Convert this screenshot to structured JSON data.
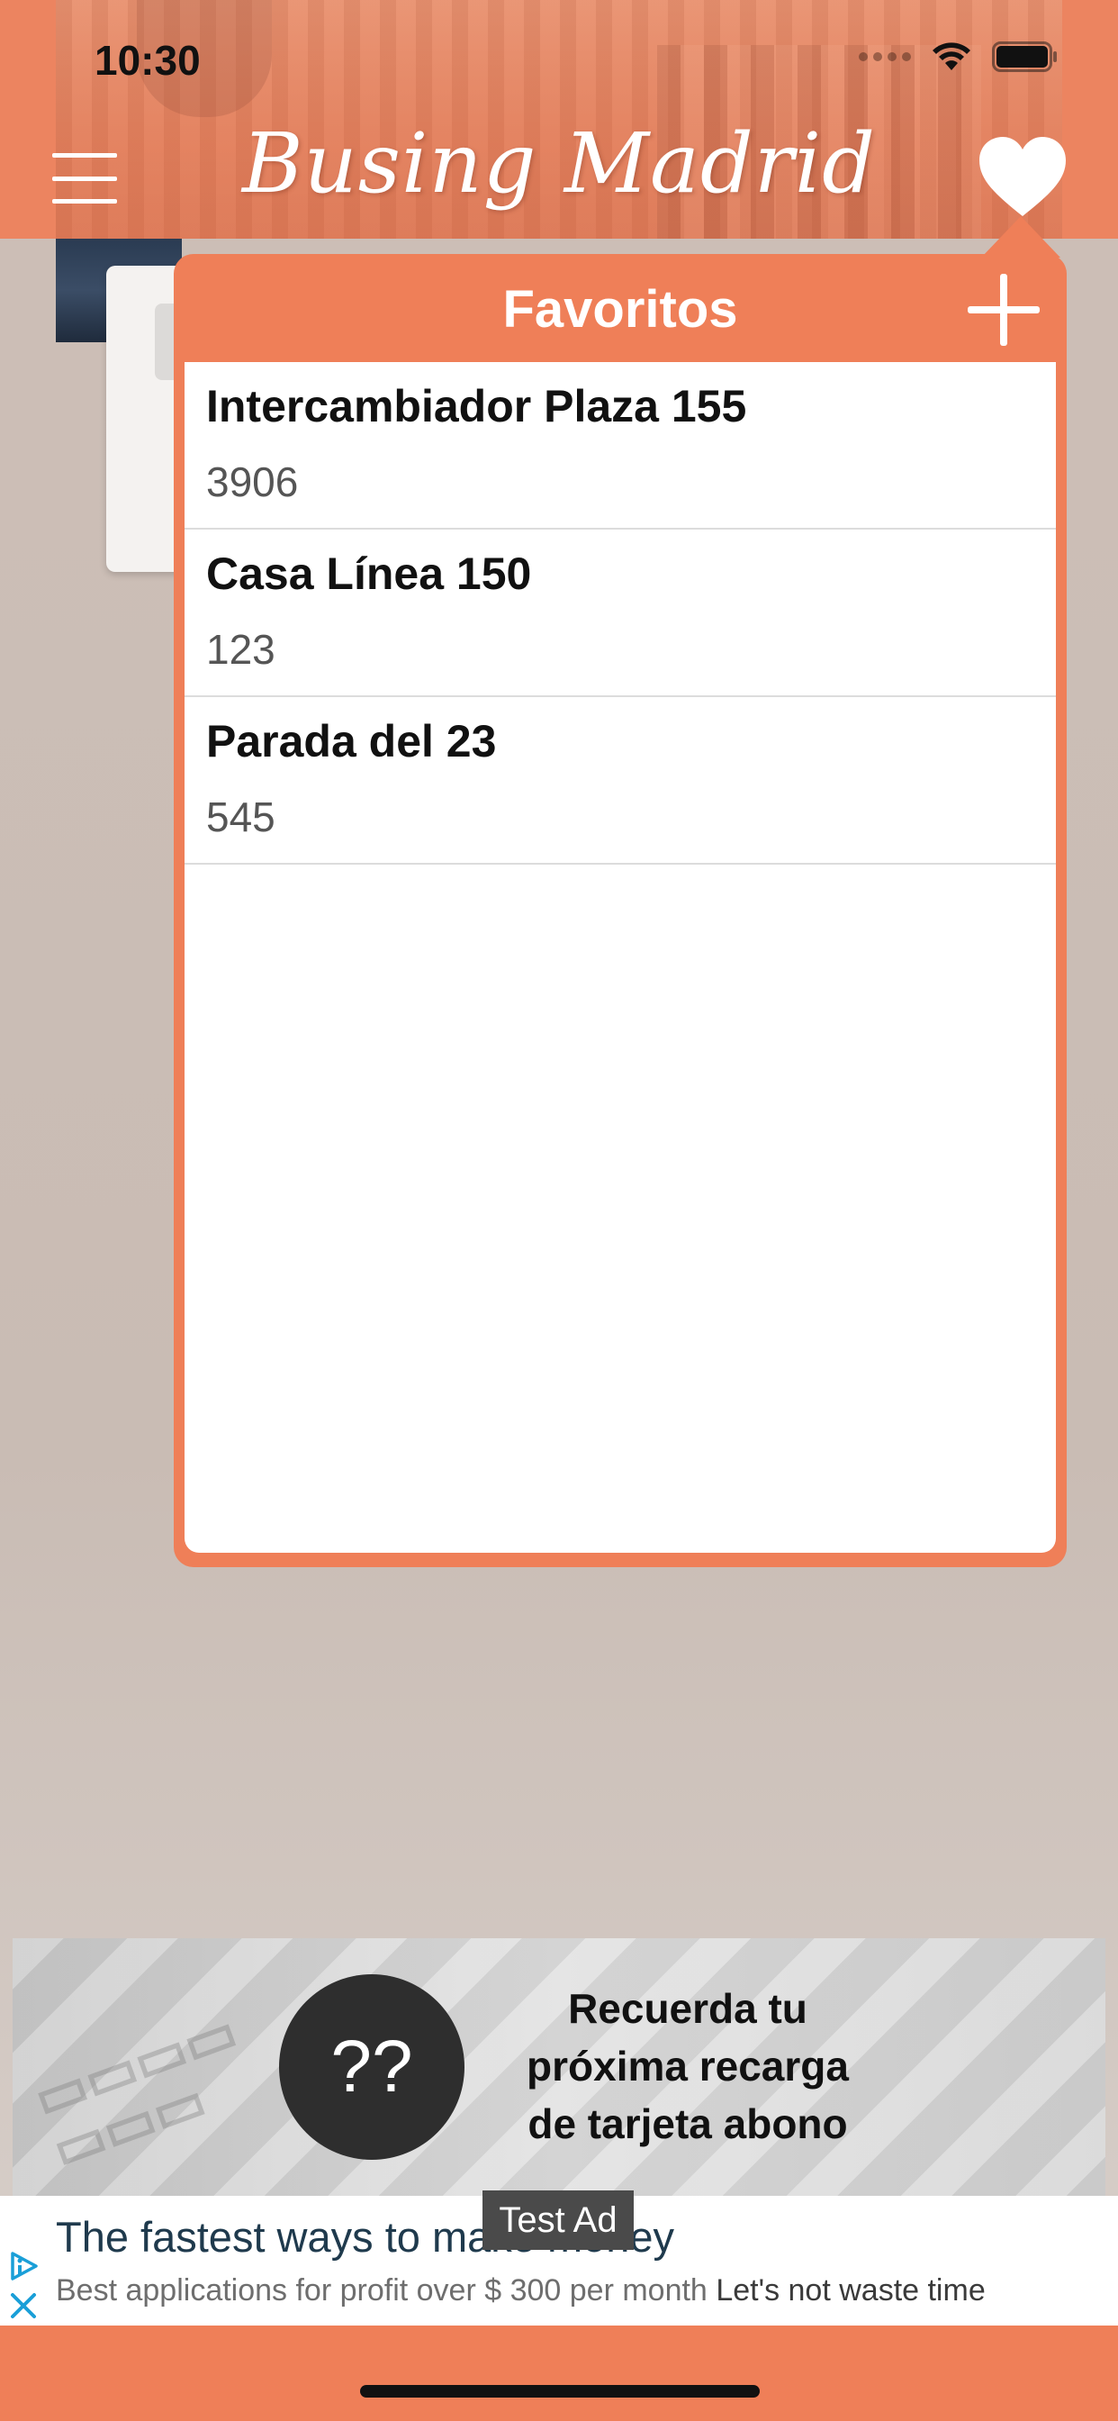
{
  "status_bar": {
    "time": "10:30"
  },
  "header": {
    "title": "Busing Madrid"
  },
  "favorites": {
    "title": "Favoritos",
    "items": [
      {
        "name": "Intercambiador Plaza 155",
        "code": "3906"
      },
      {
        "name": "Casa Línea 150",
        "code": "123"
      },
      {
        "name": "Parada del 23",
        "code": "545"
      }
    ]
  },
  "promo": {
    "badge": "??",
    "line1": "Recuerda tu",
    "line2": "próxima recarga",
    "line3": "de tarjeta abono"
  },
  "ad": {
    "label": "Test Ad",
    "headline": "The fastest ways to make money",
    "body": "Best applications for profit over $ 300 per month",
    "body_emphasis": "Let's not waste time"
  },
  "colors": {
    "accent": "#ef7f58",
    "header": "#ec8460",
    "ad_headline": "#1f3a4d",
    "adchoices": "#1a9fd8"
  },
  "icons": [
    "menu-icon",
    "heart-icon",
    "plus-icon",
    "wifi-icon",
    "battery-icon",
    "adchoices-icon",
    "close-icon"
  ]
}
